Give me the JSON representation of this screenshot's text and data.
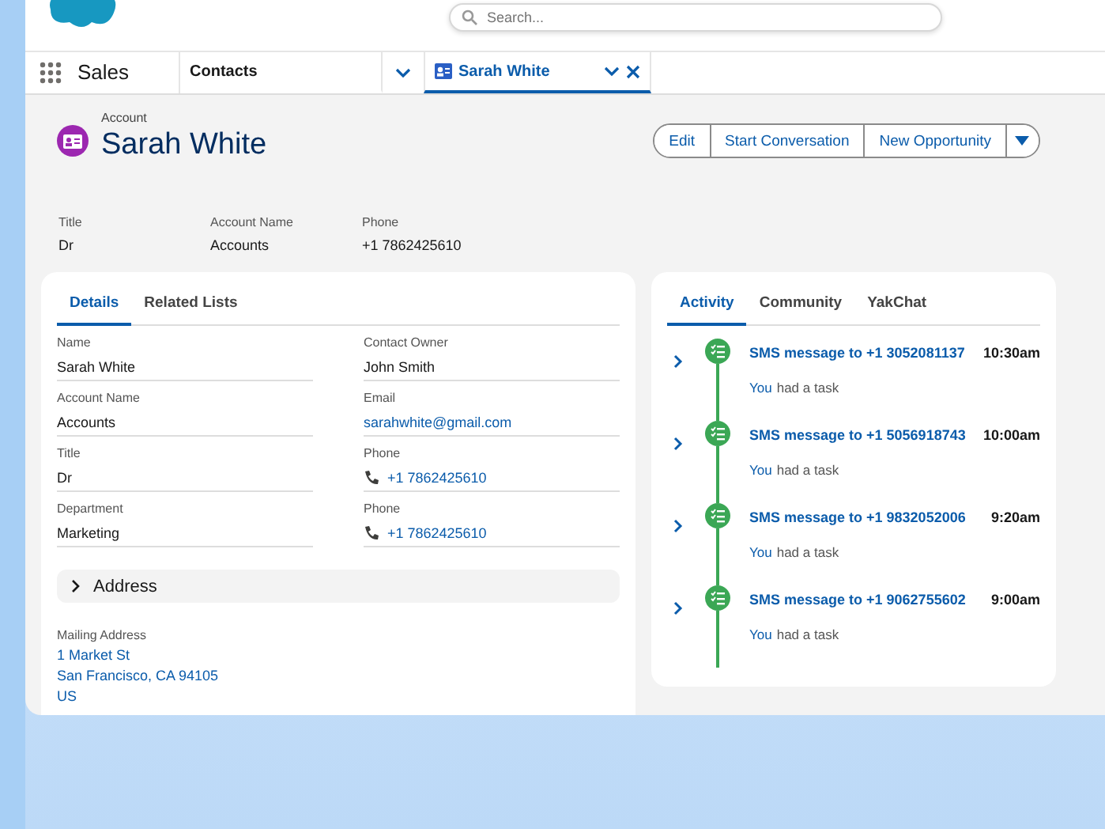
{
  "header": {
    "search": {
      "placeholder": "Search..."
    }
  },
  "nav": {
    "app_name": "Sales",
    "tabs": [
      {
        "label": "Contacts",
        "kind": "object",
        "selected": false
      },
      {
        "label": "Sarah White",
        "kind": "record",
        "selected": true
      }
    ]
  },
  "record": {
    "object_label": "Account",
    "title": "Sarah White",
    "actions": [
      "Edit",
      "Start Conversation",
      "New Opportunity"
    ],
    "highlights": [
      {
        "label": "Title",
        "value": "Dr"
      },
      {
        "label": "Account Name",
        "value": "Accounts"
      },
      {
        "label": "Phone",
        "value": "+1 7862425610"
      }
    ]
  },
  "details": {
    "tabs": [
      {
        "label": "Details",
        "selected": true
      },
      {
        "label": "Related Lists",
        "selected": false
      }
    ],
    "fields": [
      {
        "label": "Name",
        "value": "Sarah White",
        "kind": "text"
      },
      {
        "label": "Contact Owner",
        "value": "John Smith",
        "kind": "text"
      },
      {
        "label": "Account Name",
        "value": "Accounts",
        "kind": "text"
      },
      {
        "label": "Email",
        "value": "sarahwhite@gmail.com",
        "kind": "link"
      },
      {
        "label": "Title",
        "value": "Dr",
        "kind": "text"
      },
      {
        "label": "Phone",
        "value": "+1 7862425610",
        "kind": "phone"
      },
      {
        "label": "Department",
        "value": "Marketing",
        "kind": "text"
      },
      {
        "label": "Phone",
        "value": "+1 7862425610",
        "kind": "phone"
      }
    ],
    "section": {
      "title": "Address",
      "expanded": false
    },
    "mailing_address": {
      "label": "Mailing Address",
      "lines": [
        "1 Market St",
        "San Francisco, CA 94105",
        "US"
      ]
    }
  },
  "activity": {
    "tabs": [
      {
        "label": "Activity",
        "selected": true
      },
      {
        "label": "Community",
        "selected": false
      },
      {
        "label": "YakChat",
        "selected": false
      }
    ],
    "items": [
      {
        "title": "SMS message to +1 3052081137",
        "time": "10:30am",
        "actor": "You",
        "text": "had a task"
      },
      {
        "title": "SMS message to +1 5056918743",
        "time": "10:00am",
        "actor": "You",
        "text": "had a task"
      },
      {
        "title": "SMS message to +1 9832052006",
        "time": "9:20am",
        "actor": "You",
        "text": "had a task"
      },
      {
        "title": "SMS message to +1 9062755602",
        "time": "9:00am",
        "actor": "You",
        "text": "had a task"
      }
    ]
  }
}
